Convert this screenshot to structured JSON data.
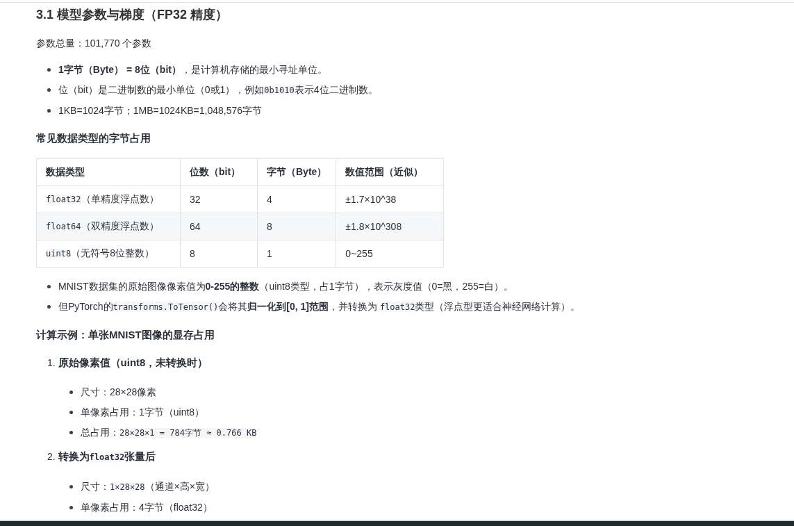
{
  "blocks": [
    {
      "kind": "h3",
      "parts": [
        {
          "kind": "text",
          "text": "3.1 模型参数与梯度（FP32 精度）"
        }
      ]
    },
    {
      "kind": "p",
      "parts": [
        {
          "kind": "text",
          "text": "参数总量：101,770 个参数"
        }
      ]
    },
    {
      "kind": "ul",
      "items": [
        {
          "parts": [
            {
              "kind": "bold",
              "text": "1字节（Byte） = 8位（bit）"
            },
            {
              "kind": "text",
              "text": "，是计算机存储的最小寻址单位。"
            }
          ]
        },
        {
          "parts": [
            {
              "kind": "text",
              "text": "位（bit）是二进制数的最小单位（0或1），例如"
            },
            {
              "kind": "code",
              "text": "0b1010"
            },
            {
              "kind": "text",
              "text": "表示4位二进制数。"
            }
          ]
        },
        {
          "parts": [
            {
              "kind": "text",
              "text": "1KB=1024字节；1MB=1024KB=1,048,576字节"
            }
          ]
        }
      ]
    },
    {
      "kind": "h4",
      "parts": [
        {
          "kind": "text",
          "text": "常见数据类型的字节占用"
        }
      ]
    },
    {
      "kind": "table",
      "columns": [
        "数据类型",
        "位数（bit）",
        "字节（Byte）",
        "数值范围（近似）"
      ],
      "rows": [
        [
          [
            {
              "kind": "code",
              "text": "float32"
            },
            {
              "kind": "text",
              "text": "（单精度浮点数）"
            }
          ],
          [
            {
              "kind": "text",
              "text": "32"
            }
          ],
          [
            {
              "kind": "text",
              "text": "4"
            }
          ],
          [
            {
              "kind": "text",
              "text": "±1.7×10^38"
            }
          ]
        ],
        [
          [
            {
              "kind": "code",
              "text": "float64"
            },
            {
              "kind": "text",
              "text": "（双精度浮点数）"
            }
          ],
          [
            {
              "kind": "text",
              "text": "64"
            }
          ],
          [
            {
              "kind": "text",
              "text": "8"
            }
          ],
          [
            {
              "kind": "text",
              "text": "±1.8×10^308"
            }
          ]
        ],
        [
          [
            {
              "kind": "code",
              "text": "uint8"
            },
            {
              "kind": "text",
              "text": "（无符号8位整数）"
            }
          ],
          [
            {
              "kind": "text",
              "text": "8"
            }
          ],
          [
            {
              "kind": "text",
              "text": "1"
            }
          ],
          [
            {
              "kind": "text",
              "text": "0~255"
            }
          ]
        ]
      ]
    },
    {
      "kind": "ul",
      "items": [
        {
          "parts": [
            {
              "kind": "text",
              "text": "MNIST数据集的原始图像像素值为"
            },
            {
              "kind": "bold",
              "text": "0-255的整数"
            },
            {
              "kind": "text",
              "text": "（uint8类型，占1字节），表示灰度值（0=黑，255=白）。"
            }
          ]
        },
        {
          "parts": [
            {
              "kind": "text",
              "text": "但PyTorch的"
            },
            {
              "kind": "code",
              "text": "transforms.ToTensor()"
            },
            {
              "kind": "text",
              "text": "会将其"
            },
            {
              "kind": "bold",
              "text": "归一化到[0, 1]范围"
            },
            {
              "kind": "text",
              "text": "，并转换为 "
            },
            {
              "kind": "code",
              "text": "float32"
            },
            {
              "kind": "text",
              "text": "类型（浮点型更适合神经网络计算）。"
            }
          ]
        }
      ]
    },
    {
      "kind": "h4",
      "parts": [
        {
          "kind": "text",
          "text": "计算示例：单张MNIST图像的显存占用"
        }
      ]
    },
    {
      "kind": "ol",
      "items": [
        {
          "marker": "1.",
          "parts": [
            {
              "kind": "text",
              "text": "原始像素值（uint8，未转换时）"
            }
          ],
          "children": [
            {
              "parts": [
                {
                  "kind": "text",
                  "text": "尺寸：28×28像素"
                }
              ]
            },
            {
              "parts": [
                {
                  "kind": "text",
                  "text": "单像素占用：1字节（uint8）"
                }
              ]
            },
            {
              "parts": [
                {
                  "kind": "text",
                  "text": "总占用："
                },
                {
                  "kind": "code",
                  "text": "28×28×1 = 784字节 ≈ 0.766 KB"
                }
              ]
            }
          ]
        },
        {
          "marker": "2.",
          "parts": [
            {
              "kind": "text",
              "text": "转换为"
            },
            {
              "kind": "code",
              "text": "float32"
            },
            {
              "kind": "text",
              "text": "张量后"
            }
          ],
          "children": [
            {
              "parts": [
                {
                  "kind": "text",
                  "text": "尺寸："
                },
                {
                  "kind": "code",
                  "text": "1×28×28"
                },
                {
                  "kind": "text",
                  "text": "（通道×高×宽）"
                }
              ]
            },
            {
              "parts": [
                {
                  "kind": "text",
                  "text": "单像素占用：4字节（float32）"
                }
              ]
            }
          ]
        }
      ]
    }
  ]
}
